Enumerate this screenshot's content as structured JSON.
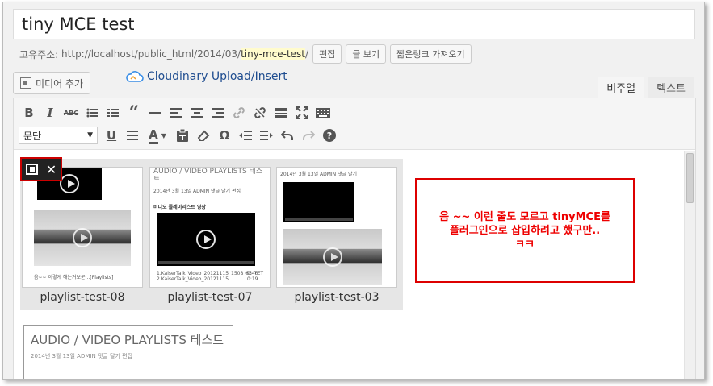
{
  "title_field": {
    "value": "tiny MCE test"
  },
  "permalink": {
    "label": "고유주소:",
    "url_prefix": "http://localhost/public_html/2014/03/",
    "slug": "tiny-mce-test",
    "url_suffix": "/",
    "edit_label": "편집",
    "view_label": "글 보기",
    "shortlink_label": "짧은링크 가져오기"
  },
  "media_button": {
    "label": "미디어 추가",
    "icon": "media-icon"
  },
  "cloudinary": {
    "label": "Cloudinary Upload/Insert",
    "icon": "cloud-icon"
  },
  "editor_tabs": [
    {
      "label": "비주얼",
      "active": true
    },
    {
      "label": "텍스트",
      "active": false
    }
  ],
  "toolbar": {
    "format_select": "문단",
    "row1_icons": [
      "bold-icon",
      "italic-icon",
      "strikethrough-icon",
      "bullet-list-icon",
      "numbered-list-icon",
      "blockquote-icon",
      "horizontal-rule-icon",
      "align-left-icon",
      "align-center-icon",
      "align-right-icon",
      "link-icon",
      "unlink-icon",
      "read-more-icon",
      "fullscreen-icon",
      "toolbar-toggle-icon"
    ],
    "row2_icons": [
      "underline-icon",
      "justify-icon",
      "text-color-icon",
      "paste-text-icon",
      "clear-formatting-icon",
      "special-character-icon",
      "outdent-icon",
      "indent-icon",
      "undo-icon",
      "redo-icon",
      "help-icon"
    ],
    "bold": "B",
    "italic": "I",
    "strike": "ABC",
    "quote": "“",
    "underline": "U",
    "color": "A",
    "omega": "Ω",
    "help": "?"
  },
  "gallery": {
    "items": [
      {
        "caption": "playlist-test-08",
        "snippet": "음~~ 이렇게 해는거보군...[Playlists]"
      },
      {
        "caption": "playlist-test-07",
        "header": "AUDIO / VIDEO PLAYLISTS 테스트",
        "meta": "2014년 3월 13일  ADMIN  댓글 달기  편집",
        "heading": "비디오 플레이리스트 영상",
        "track1": "1.KaiserTalk_Video_20121115_1508_65_TET",
        "track2": "2.KaiserTalk_Video_20121115",
        "dur1": "0:46",
        "dur2": "0:19"
      },
      {
        "caption": "playlist-test-03",
        "meta": "2014년 3월 13일  ADMIN  댓글 달기"
      }
    ],
    "tools": {
      "edit_icon": "gallery-edit-icon",
      "close": "✕"
    }
  },
  "note": {
    "text": "음 ~~ 이런 줄도 모르고 tinyMCE를\n플러그인으로 삽입하려고 했구만..\nㅋㅋ"
  },
  "post_preview": {
    "title": "AUDIO / VIDEO PLAYLISTS 테스트",
    "meta": "2014년 3월 13일    ADMIN    댓글 달기    편집"
  }
}
